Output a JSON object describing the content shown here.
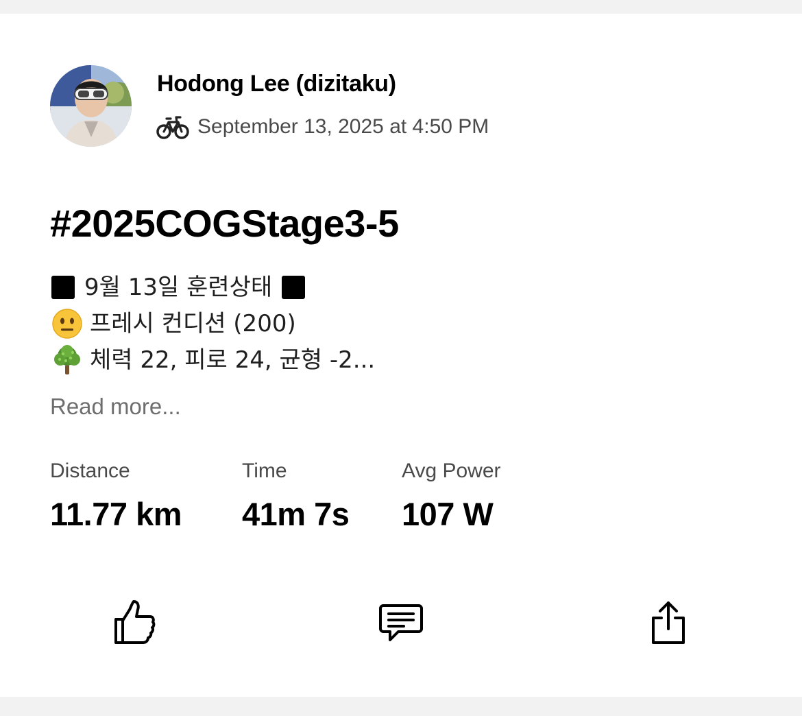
{
  "post": {
    "author_name": "Hodong Lee (dizitaku)",
    "activity_icon": "bike-icon",
    "timestamp": "September 13, 2025 at 4:50 PM",
    "title": "#2025COGStage3-5",
    "description": {
      "line1_text": "9월 13일 훈련상태",
      "line2_emoji": "neutral-face-emoji",
      "line2_text": "프레시 컨디션 (200)",
      "line3_emoji": "tree-emoji",
      "line3_text": "체력 22, 피로 24, 균형 -2..."
    },
    "read_more": "Read more...",
    "stats": [
      {
        "label": "Distance",
        "value": "11.77 km"
      },
      {
        "label": "Time",
        "value": "41m 7s"
      },
      {
        "label": "Avg Power",
        "value": "107 W"
      }
    ],
    "actions": {
      "like_icon": "thumbs-up-icon",
      "comment_icon": "comment-icon",
      "share_icon": "share-icon"
    }
  }
}
